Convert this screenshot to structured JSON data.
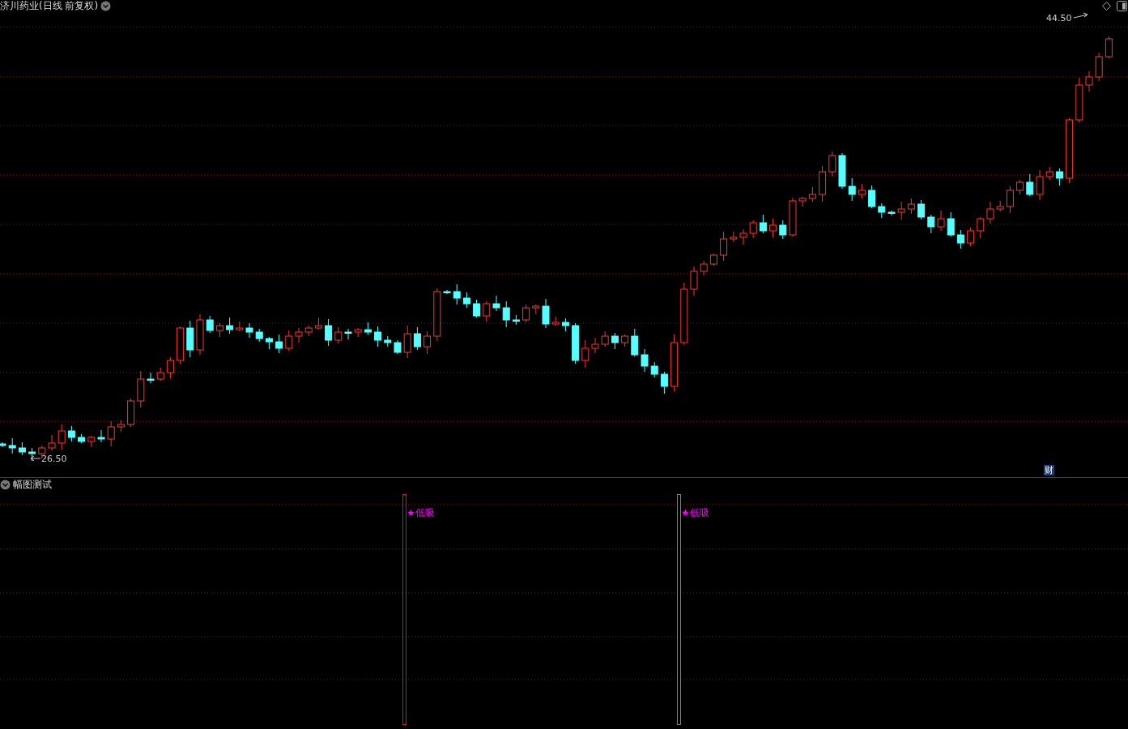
{
  "chart_title": "济川药业(日线 前复权)",
  "high_label": "44.50",
  "low_label": "26.50",
  "finance_badge": "财",
  "indicator_panel": {
    "title": "幅图测试",
    "signals": [
      {
        "label": "★低吸",
        "color": "#ff0000"
      },
      {
        "label": "★低吸",
        "color": "#808080"
      }
    ]
  }
}
